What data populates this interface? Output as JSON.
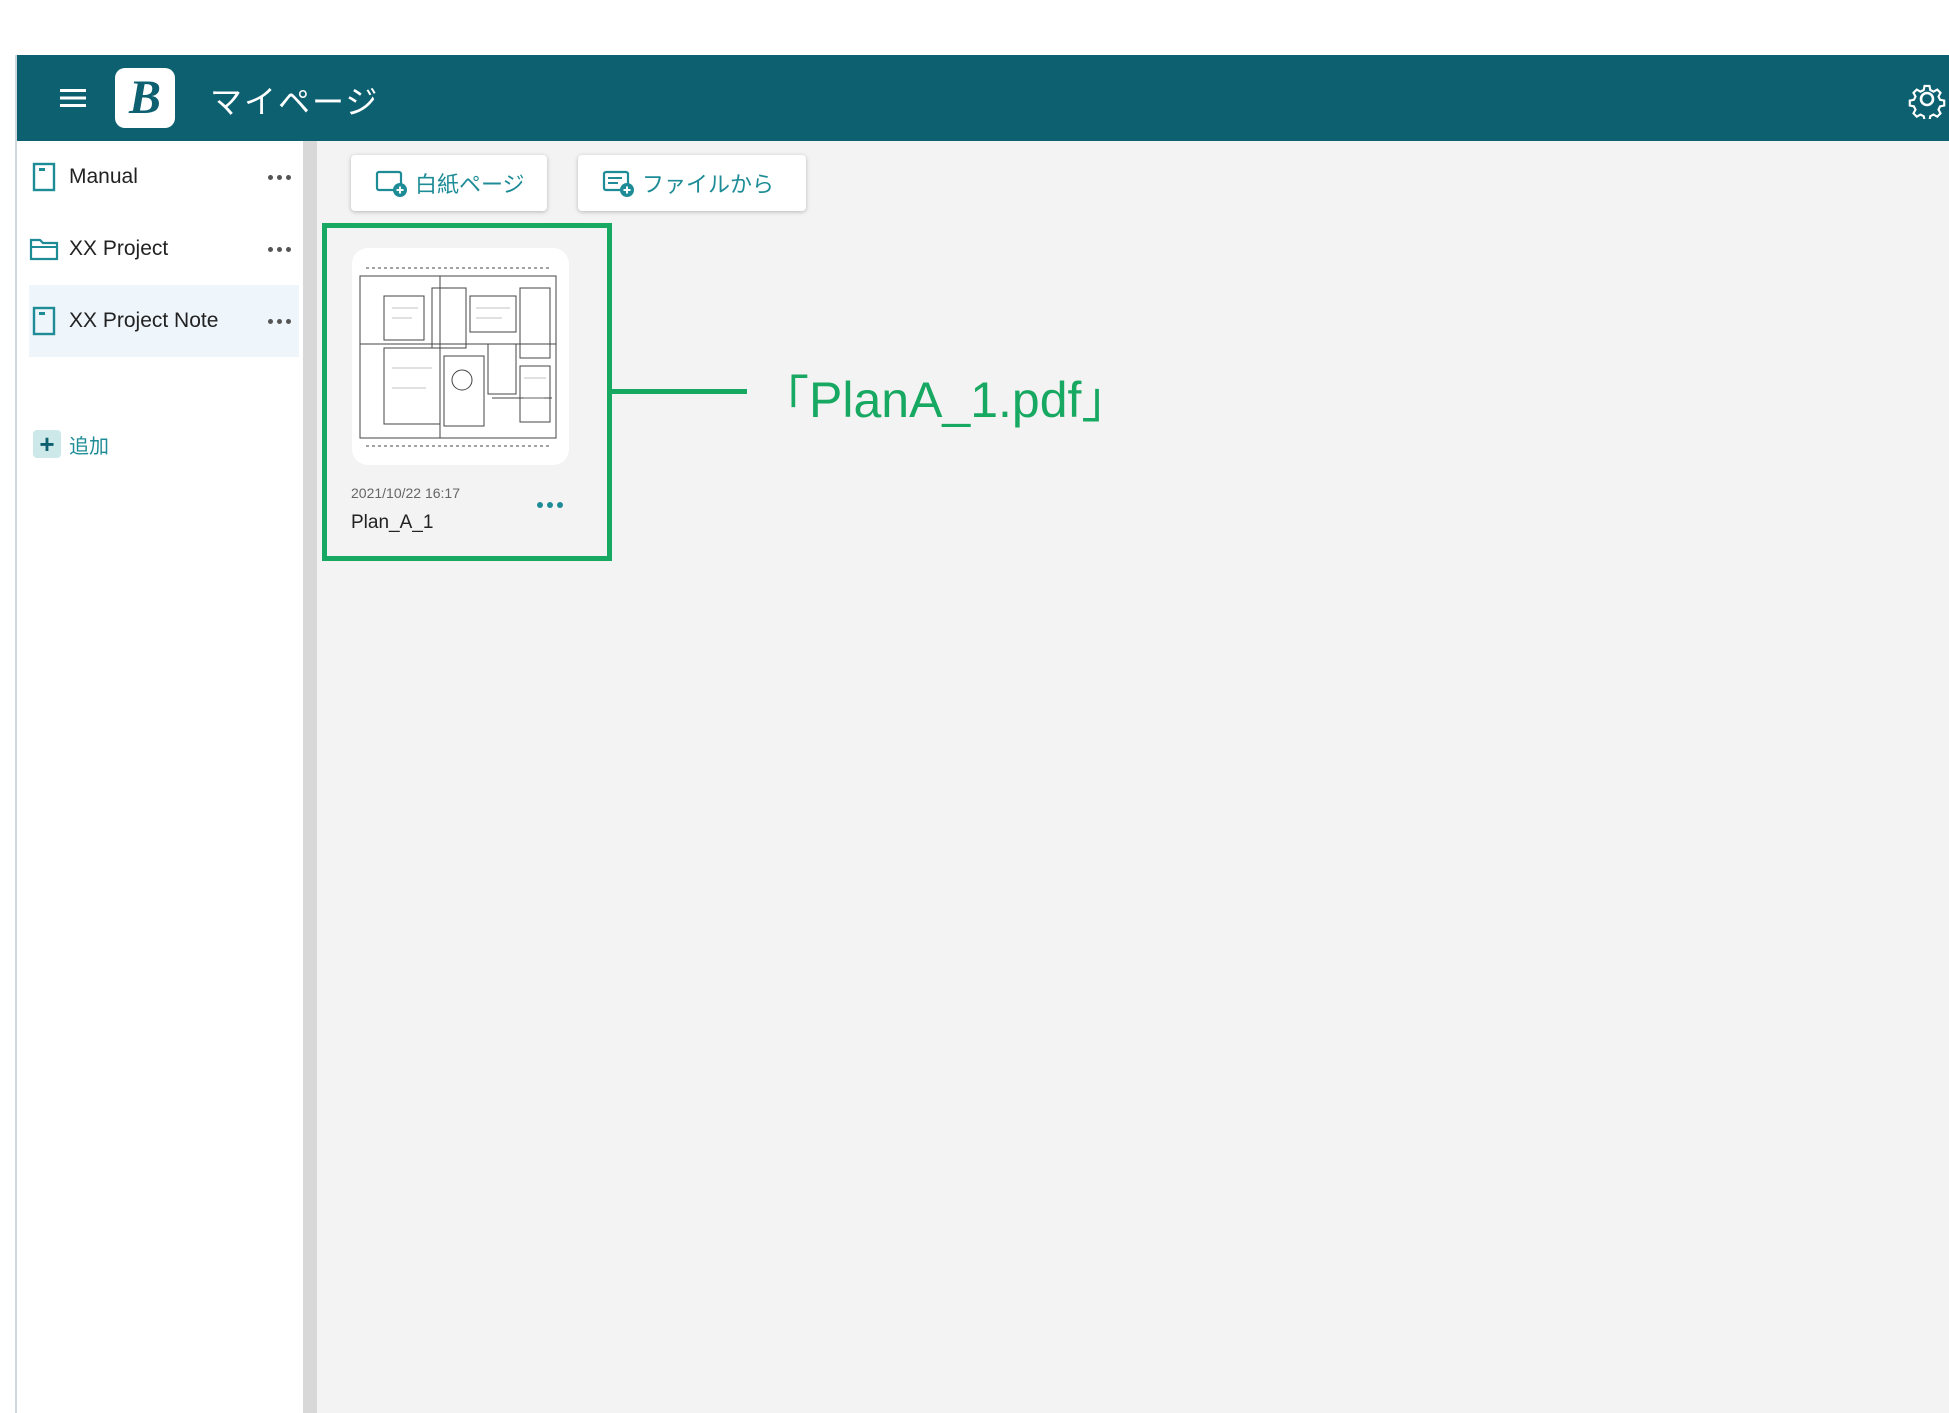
{
  "header": {
    "title": "マイページ",
    "logo_letter": "B"
  },
  "sidebar": {
    "items": [
      {
        "label": "Manual",
        "icon": "notebook-icon"
      },
      {
        "label": "XX Project",
        "icon": "folder-icon"
      },
      {
        "label": "XX Project Note",
        "icon": "notebook-icon",
        "active": true
      }
    ],
    "add_label": "追加"
  },
  "toolbar": {
    "blank_page_label": "白紙ページ",
    "from_file_label": "ファイルから"
  },
  "card": {
    "date": "2021/10/22 16:17",
    "name": "Plan_A_1"
  },
  "annotation": {
    "text": "「PlanA_1.pdf」"
  },
  "colors": {
    "header_bg": "#0c6070",
    "accent": "#1e8c96",
    "annotation_green": "#17a862"
  }
}
